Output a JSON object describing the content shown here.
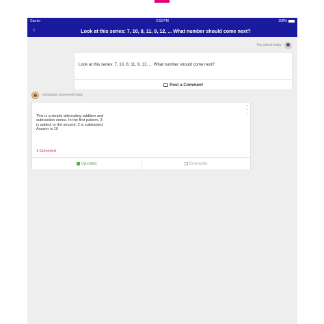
{
  "status_bar": {
    "carrier": "Carrier",
    "time": "2:53 PM",
    "battery": "100%"
  },
  "nav": {
    "back_glyph": "‹",
    "title": "Look at this series: 7, 10, 8, 11, 9, 12, ... What number should come next?"
  },
  "question": {
    "asked_label": "You asked today",
    "text": "Look at this series: 7, 10, 8, 11, 9, 12, ... What number should come next?",
    "post_comment": "Post a Comment"
  },
  "answer": {
    "author_label": "nchantutor answered today",
    "text": "This is a simple alternating addition and subtraction series. In the first pattern, 3 is added; in the second, 2 is subtracted. Answer is 10",
    "comments_link": "1 Comment",
    "upvote_label": "Upvoted",
    "downvote_label": "Downvote"
  },
  "colors": {
    "brand_blue": "#1a1a9e",
    "accent_pink": "#e0007a",
    "upvote_green": "#4caf50"
  },
  "icons": [
    "back-chevron-icon",
    "battery-icon",
    "comment-icon",
    "more-vertical-icon",
    "thumbs-up-icon",
    "thumbs-down-icon"
  ]
}
